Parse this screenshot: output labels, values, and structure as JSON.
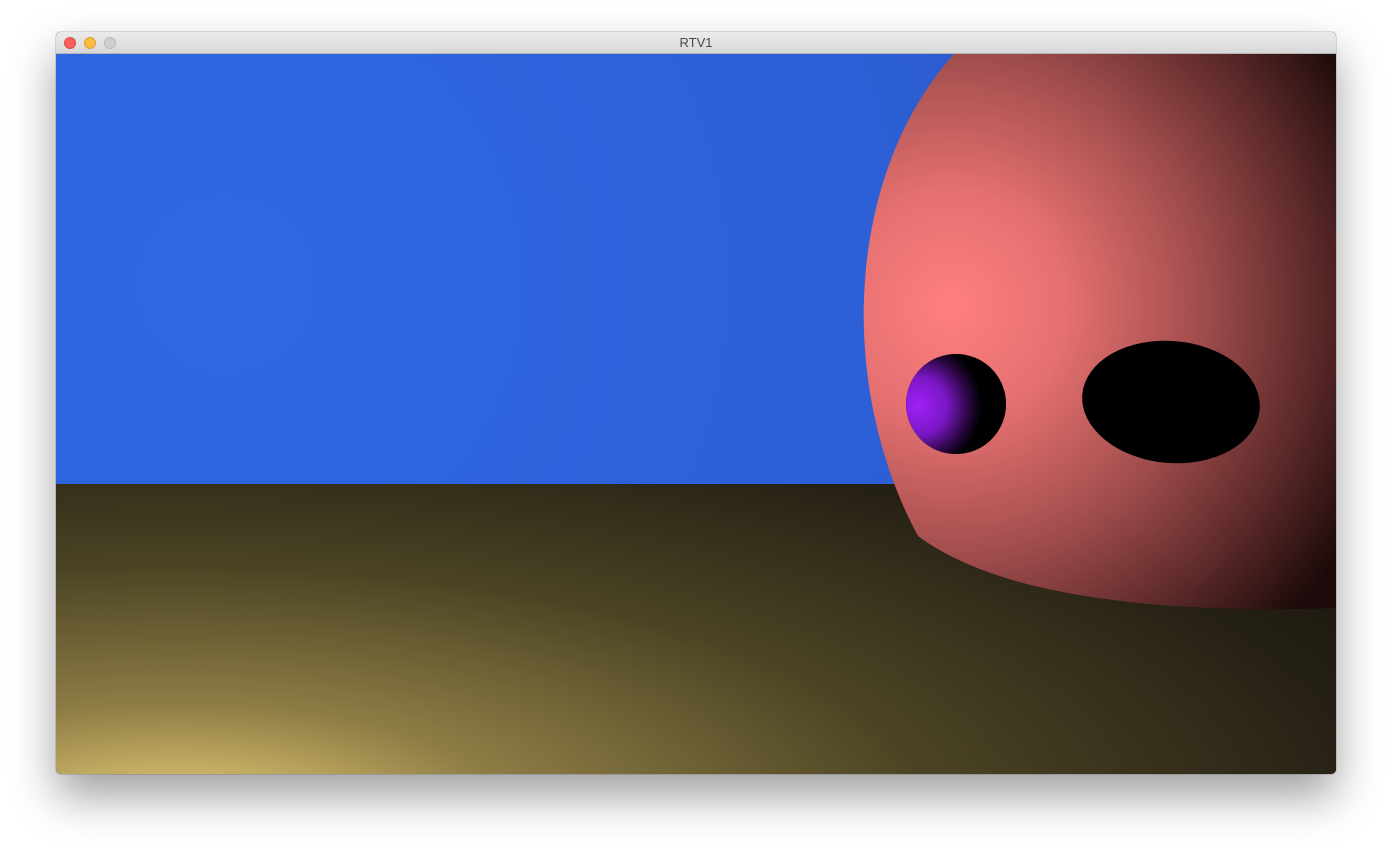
{
  "window": {
    "title": "RTV1"
  },
  "controls": {
    "close_icon": "traffic-light-close",
    "minimize_icon": "traffic-light-minimize",
    "zoom_icon": "traffic-light-zoom"
  },
  "scene": {
    "sky_color": "#2e64dc",
    "floor_color_near": "#e6ca75",
    "floor_color_far": "#16120c",
    "large_sphere_color": "#ff7f7f",
    "small_sphere_color": "#9b1df3",
    "shadow_color": "#000000"
  }
}
